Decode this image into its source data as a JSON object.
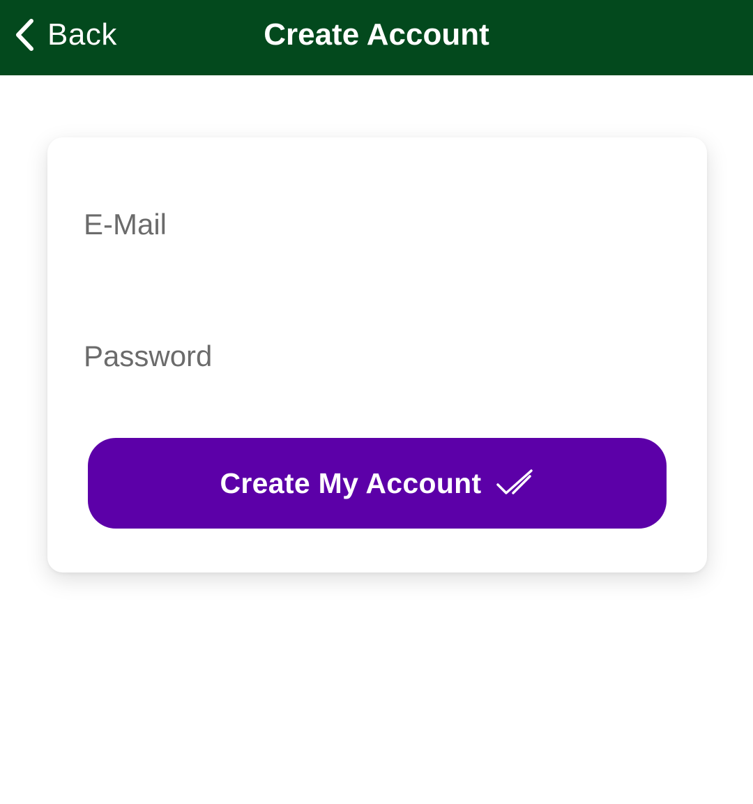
{
  "header": {
    "back_label": "Back",
    "title": "Create Account",
    "background_color": "#03491d"
  },
  "form": {
    "email": {
      "placeholder": "E-Mail",
      "value": ""
    },
    "password": {
      "placeholder": "Password",
      "value": ""
    },
    "submit_label": "Create My Account",
    "submit_icon": "double-check-icon",
    "submit_color": "#5c00a8"
  }
}
